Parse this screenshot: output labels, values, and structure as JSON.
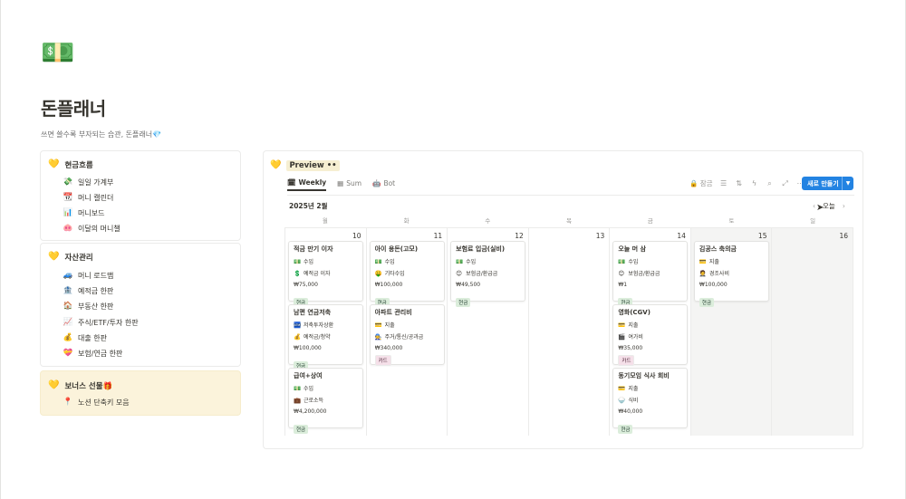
{
  "page": {
    "icon": "💵",
    "title": "돈플래너",
    "description": "쓰면 쓸수록 부자되는 습관, 돈플래너💎"
  },
  "sections": [
    {
      "title": "현금흐름",
      "icon": "💛",
      "links": [
        {
          "icon": "💸",
          "label": "일일 가계부"
        },
        {
          "icon": "📆",
          "label": "머니 캘린더"
        },
        {
          "icon": "📊",
          "label": "머니보드"
        },
        {
          "icon": "🐽",
          "label": "이달의 머니챌"
        }
      ]
    },
    {
      "title": "자산관리",
      "icon": "💛",
      "links": [
        {
          "icon": "🚙",
          "label": "머니 로드맵"
        },
        {
          "icon": "🏦",
          "label": "예적금 한판"
        },
        {
          "icon": "🏠",
          "label": "부동산 한판"
        },
        {
          "icon": "📈",
          "label": "주식/ETF/투자 한판"
        },
        {
          "icon": "💰",
          "label": "대출 한판"
        },
        {
          "icon": "💝",
          "label": "보험/연금 한판"
        }
      ]
    },
    {
      "title": "보너스 선물🎁",
      "icon": "💛",
      "links": [
        {
          "icon": "📍",
          "label": "노션 단축키 모음"
        }
      ]
    }
  ],
  "preview": {
    "icon": "💛",
    "title": "Preview",
    "title_suffix": "••",
    "tabs": [
      {
        "icon": "🗓",
        "label": "Weekly",
        "active": true
      },
      {
        "icon": "▦",
        "label": "Sum",
        "active": false
      },
      {
        "icon": "🤖",
        "label": "Bot",
        "active": false
      }
    ],
    "lock_label": "잠금",
    "new_button": "새로 만들기",
    "month": "2025년 2월",
    "today": "오늘",
    "weekdays": [
      "월",
      "화",
      "수",
      "목",
      "금",
      "토",
      "일"
    ],
    "days": [
      {
        "num": "10",
        "weekend": false,
        "events": [
          {
            "title": "적금 만기 이자",
            "type_icon": "💵",
            "type": "수입",
            "cat_icon": "💲",
            "category": "예적금 이자",
            "amount": "₩75,000",
            "tag": "현금",
            "tag_kind": "cash"
          },
          {
            "title": "남편 연금저축",
            "type_icon": "🏧",
            "type": "저축투자상환",
            "cat_icon": "💰",
            "category": "예적금/청약",
            "amount": "₩100,000",
            "tag": "현금",
            "tag_kind": "cash"
          },
          {
            "title": "급여+상여",
            "type_icon": "💵",
            "type": "수입",
            "cat_icon": "💼",
            "category": "근로소득",
            "amount": "₩4,200,000",
            "tag": "현금",
            "tag_kind": "cash"
          }
        ]
      },
      {
        "num": "11",
        "weekend": false,
        "events": [
          {
            "title": "아이 용돈(고모)",
            "type_icon": "💵",
            "type": "수입",
            "cat_icon": "🤑",
            "category": "기타수입",
            "amount": "₩100,000",
            "tag": "현금",
            "tag_kind": "cash"
          },
          {
            "title": "아파트 관리비",
            "type_icon": "💳",
            "type": "지출",
            "cat_icon": "🧑‍🔧",
            "category": "주거/통신/공과금",
            "amount": "₩340,000",
            "tag": "카드",
            "tag_kind": "card"
          }
        ]
      },
      {
        "num": "12",
        "weekend": false,
        "events": [
          {
            "title": "보험료 입금(실비)",
            "type_icon": "💵",
            "type": "수입",
            "cat_icon": "😊",
            "category": "보험금/환급금",
            "amount": "₩49,500",
            "tag": "현금",
            "tag_kind": "cash"
          }
        ]
      },
      {
        "num": "13",
        "weekend": false,
        "events": []
      },
      {
        "num": "14",
        "weekend": false,
        "events": [
          {
            "title": "오늘 머 삼",
            "type_icon": "💵",
            "type": "수입",
            "cat_icon": "😊",
            "category": "보험금/환급금",
            "amount": "₩1",
            "tag": "현금",
            "tag_kind": "cash"
          },
          {
            "title": "영화(CGV)",
            "type_icon": "💳",
            "type": "지출",
            "cat_icon": "🎬",
            "category": "여가비",
            "amount": "₩35,000",
            "tag": "카드",
            "tag_kind": "card"
          },
          {
            "title": "동기모임 식사 회비",
            "type_icon": "💳",
            "type": "지출",
            "cat_icon": "🍚",
            "category": "식비",
            "amount": "₩40,000",
            "tag": "현금",
            "tag_kind": "cash"
          }
        ]
      },
      {
        "num": "15",
        "weekend": true,
        "events": [
          {
            "title": "김공스 축의금",
            "type_icon": "💳",
            "type": "지출",
            "cat_icon": "🤵",
            "category": "경조사비",
            "amount": "₩100,000",
            "tag": "현금",
            "tag_kind": "cash"
          }
        ]
      },
      {
        "num": "16",
        "weekend": true,
        "events": []
      }
    ]
  }
}
